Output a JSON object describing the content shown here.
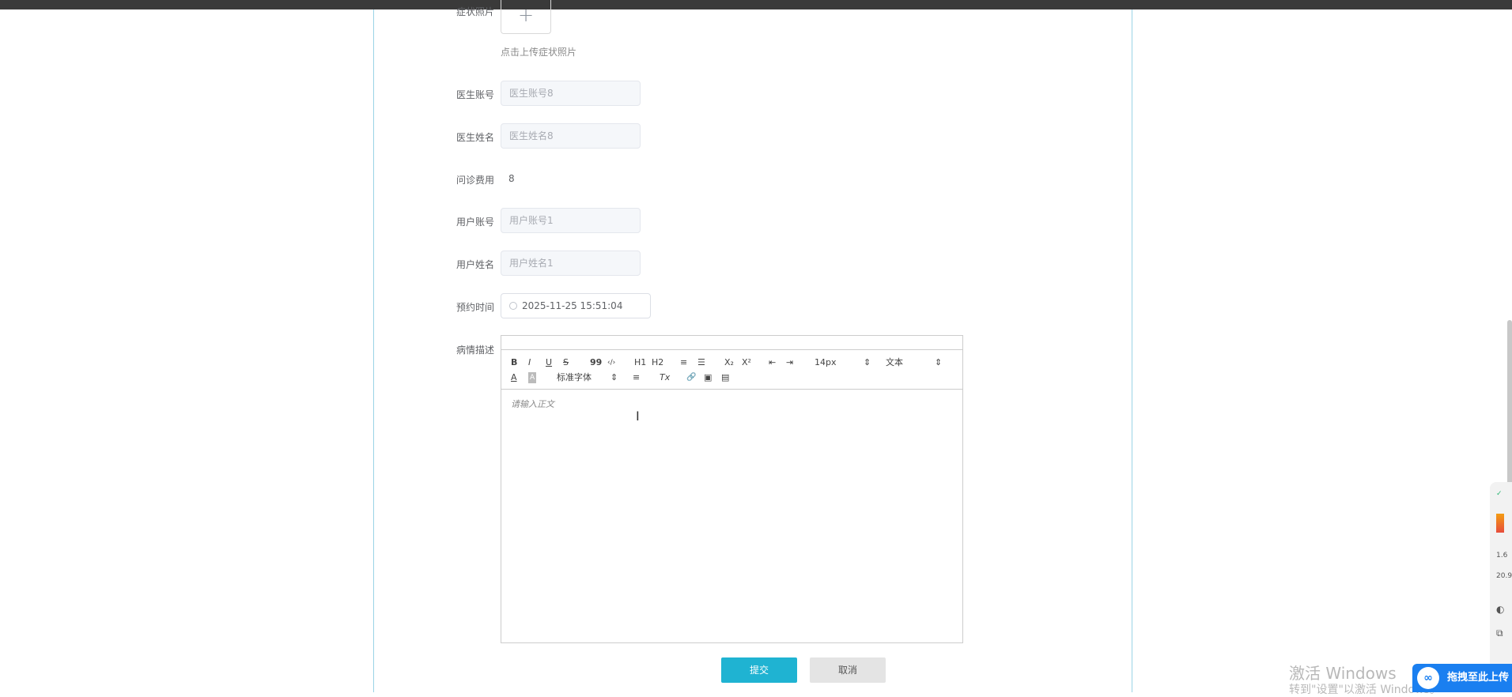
{
  "form": {
    "photo_label": "症状照片",
    "upload_plus": "+",
    "upload_tip": "点击上传症状照片",
    "doctor_account_label": "医生账号",
    "doctor_account_value": "医生账号8",
    "doctor_name_label": "医生姓名",
    "doctor_name_value": "医生姓名8",
    "fee_label": "问诊费用",
    "fee_value": "8",
    "user_account_label": "用户账号",
    "user_account_value": "用户账号1",
    "user_name_label": "用户姓名",
    "user_name_value": "用户姓名1",
    "appointment_label": "预约时间",
    "appointment_value": "2025-11-25 15:51:04",
    "description_label": "病情描述"
  },
  "editor": {
    "bold": "B",
    "italic": "I",
    "underline": "U",
    "strike": "S",
    "quote": "99",
    "code": "‹/›",
    "h1": "H1",
    "h2": "H2",
    "ordered_list": "≡",
    "bullet_list": "☰",
    "subscript": "X₂",
    "superscript": "X²",
    "indent_dec": "⇤",
    "indent_inc": "⇥",
    "size": "14px",
    "header": "文本",
    "color": "A",
    "background": "A",
    "font": "标准字体",
    "align": "≡",
    "clean": "Tx",
    "link": "🔗",
    "image": "▣",
    "video": "▤",
    "placeholder": "请输入正文"
  },
  "actions": {
    "submit": "提交",
    "cancel": "取消"
  },
  "overlay": {
    "watermark_line1": "激活 Windows",
    "watermark_line2": "转到\"设置\"以激活 Windows。",
    "upload_pill": "拖拽至此上传",
    "side_stat1": "1.6",
    "side_stat2": "20.9"
  },
  "colors": {
    "accent": "#1fb3d2",
    "panel_border": "#9ad3e6",
    "upload_pill": "#1a7ff0"
  }
}
